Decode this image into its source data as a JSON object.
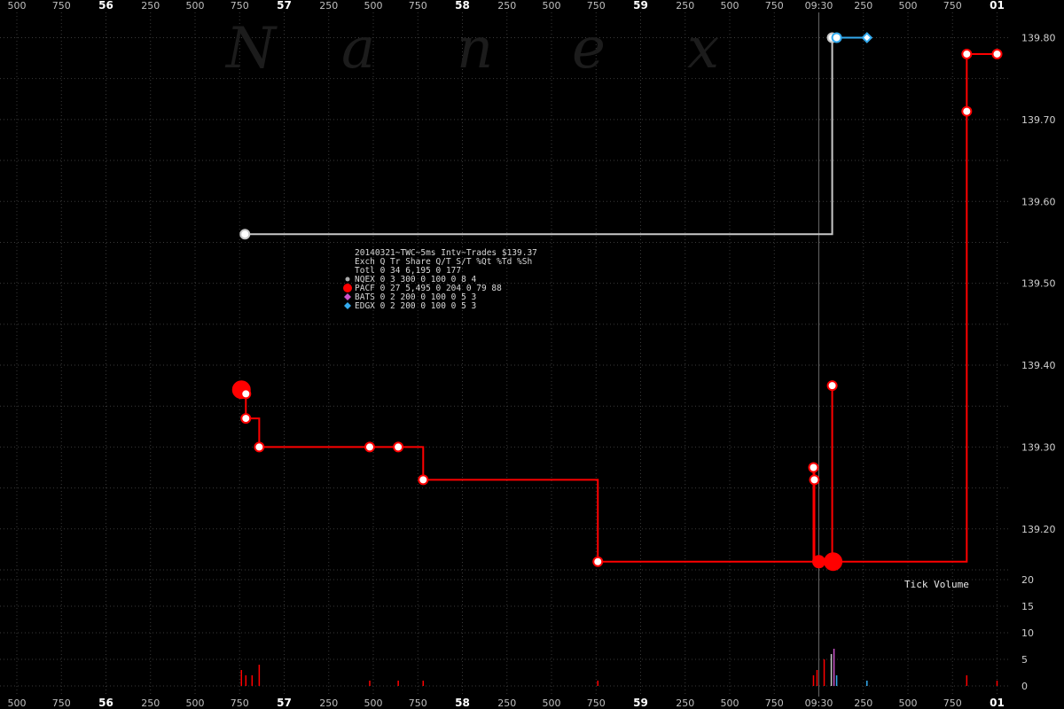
{
  "chart_data": {
    "type": "line",
    "watermark": [
      "N",
      "a",
      "n",
      "e",
      "x"
    ],
    "info_box": {
      "title": "20140321~TWC~5ms Intv~Trades $139.37",
      "header": "Exch Q Tr Share  Q/T    S/T  %Qt %Td %Sh",
      "rows": [
        {
          "text": "Totl 0 34 6,195    0   177",
          "marker": "none",
          "color": ""
        },
        {
          "text": "NQEX 0  3   300    0   100   0   8   4",
          "marker": "dot",
          "color": "#aaaaaa"
        },
        {
          "text": "PACF 0 27 5,495    0   204   0  79  88",
          "marker": "bigdot",
          "color": "#ff0000"
        },
        {
          "text": "BATS 0  2   200    0   100   0   5   3",
          "marker": "diamond",
          "color": "#cc55cc"
        },
        {
          "text": "EDGX 0  2   200    0   100   0   5   3",
          "marker": "diamond",
          "color": "#33aaee"
        }
      ]
    },
    "x_axis": {
      "ticks": [
        {
          "label": "500",
          "major": false
        },
        {
          "label": "750",
          "major": false
        },
        {
          "label": "56",
          "major": true
        },
        {
          "label": "250",
          "major": false
        },
        {
          "label": "500",
          "major": false
        },
        {
          "label": "750",
          "major": false
        },
        {
          "label": "57",
          "major": true
        },
        {
          "label": "250",
          "major": false
        },
        {
          "label": "500",
          "major": false
        },
        {
          "label": "750",
          "major": false
        },
        {
          "label": "58",
          "major": true
        },
        {
          "label": "250",
          "major": false
        },
        {
          "label": "500",
          "major": false
        },
        {
          "label": "750",
          "major": false
        },
        {
          "label": "59",
          "major": true
        },
        {
          "label": "250",
          "major": false
        },
        {
          "label": "500",
          "major": false
        },
        {
          "label": "750",
          "major": false
        },
        {
          "label": "09:30",
          "major": false
        },
        {
          "label": "250",
          "major": false
        },
        {
          "label": "500",
          "major": false
        },
        {
          "label": "750",
          "major": false
        },
        {
          "label": "01",
          "major": true
        }
      ],
      "range": [
        -0.5,
        5.0
      ],
      "reference_time": 4.0
    },
    "price_axis": {
      "range": [
        139.15,
        139.82
      ],
      "ticks": [
        "139.20",
        "139.30",
        "139.40",
        "139.50",
        "139.60",
        "139.70",
        "139.80"
      ]
    },
    "volume_axis": {
      "label": "Tick Volume",
      "range": [
        0,
        23
      ],
      "ticks": [
        "0",
        "5",
        "10",
        "15",
        "20"
      ]
    },
    "series": [
      {
        "name": "PACF",
        "color": "#ff0000",
        "steps": [
          [
            0.76,
            139.37
          ],
          [
            0.785,
            139.365
          ],
          [
            0.785,
            139.335
          ],
          [
            0.86,
            139.335
          ],
          [
            0.86,
            139.3
          ],
          [
            1.48,
            139.3
          ],
          [
            1.78,
            139.3
          ],
          [
            1.78,
            139.26
          ],
          [
            2.76,
            139.26
          ],
          [
            2.76,
            139.16
          ],
          [
            3.97,
            139.16
          ],
          [
            3.97,
            139.275
          ],
          [
            3.975,
            139.26
          ],
          [
            3.975,
            139.16
          ],
          [
            4.075,
            139.16
          ],
          [
            4.075,
            139.375
          ],
          [
            4.075,
            139.16
          ],
          [
            4.83,
            139.16
          ],
          [
            4.83,
            139.71
          ],
          [
            4.83,
            139.78
          ],
          [
            5.0,
            139.78
          ]
        ],
        "markers": [
          {
            "x": 0.76,
            "y": 139.37,
            "size": "large"
          },
          {
            "x": 0.785,
            "y": 139.365,
            "size": "small"
          },
          {
            "x": 0.785,
            "y": 139.335,
            "size": "small"
          },
          {
            "x": 0.86,
            "y": 139.3,
            "size": "small"
          },
          {
            "x": 1.48,
            "y": 139.3,
            "size": "small"
          },
          {
            "x": 1.64,
            "y": 139.3,
            "size": "small"
          },
          {
            "x": 1.78,
            "y": 139.26,
            "size": "small"
          },
          {
            "x": 2.76,
            "y": 139.16,
            "size": "small"
          },
          {
            "x": 3.97,
            "y": 139.275,
            "size": "small"
          },
          {
            "x": 3.975,
            "y": 139.26,
            "size": "small"
          },
          {
            "x": 4.0,
            "y": 139.16,
            "size": "medium"
          },
          {
            "x": 4.08,
            "y": 139.16,
            "size": "large"
          },
          {
            "x": 4.075,
            "y": 139.375,
            "size": "small"
          },
          {
            "x": 4.83,
            "y": 139.71,
            "size": "small"
          },
          {
            "x": 4.83,
            "y": 139.78,
            "size": "small"
          },
          {
            "x": 5.0,
            "y": 139.78,
            "size": "small"
          }
        ],
        "volume": [
          {
            "x": 0.76,
            "v": 3
          },
          {
            "x": 0.785,
            "v": 2
          },
          {
            "x": 0.82,
            "v": 2
          },
          {
            "x": 0.86,
            "v": 4
          },
          {
            "x": 1.48,
            "v": 1
          },
          {
            "x": 1.64,
            "v": 1
          },
          {
            "x": 1.78,
            "v": 1
          },
          {
            "x": 2.76,
            "v": 1
          },
          {
            "x": 3.97,
            "v": 2
          },
          {
            "x": 3.99,
            "v": 3
          },
          {
            "x": 4.03,
            "v": 5
          },
          {
            "x": 4.83,
            "v": 2
          },
          {
            "x": 5.0,
            "v": 1
          }
        ]
      },
      {
        "name": "NQEX",
        "color": "#c8c8c8",
        "steps": [
          [
            0.78,
            139.56
          ],
          [
            4.075,
            139.56
          ],
          [
            4.075,
            139.8
          ]
        ],
        "markers": [
          {
            "x": 0.78,
            "y": 139.56,
            "size": "small"
          },
          {
            "x": 4.075,
            "y": 139.8,
            "size": "small"
          }
        ],
        "volume": [
          {
            "x": 4.07,
            "v": 6
          }
        ]
      },
      {
        "name": "EDGX",
        "color": "#33aaee",
        "steps": [
          [
            4.1,
            139.8
          ],
          [
            4.27,
            139.8
          ]
        ],
        "markers": [
          {
            "x": 4.1,
            "y": 139.8,
            "size": "small",
            "shape": "circle"
          },
          {
            "x": 4.27,
            "y": 139.8,
            "size": "small",
            "shape": "diamond"
          }
        ],
        "volume": [
          {
            "x": 4.1,
            "v": 2
          },
          {
            "x": 4.27,
            "v": 1
          }
        ]
      },
      {
        "name": "BATS",
        "color": "#cc55cc",
        "steps": [],
        "markers": [],
        "volume": [
          {
            "x": 4.085,
            "v": 7
          }
        ]
      }
    ]
  }
}
